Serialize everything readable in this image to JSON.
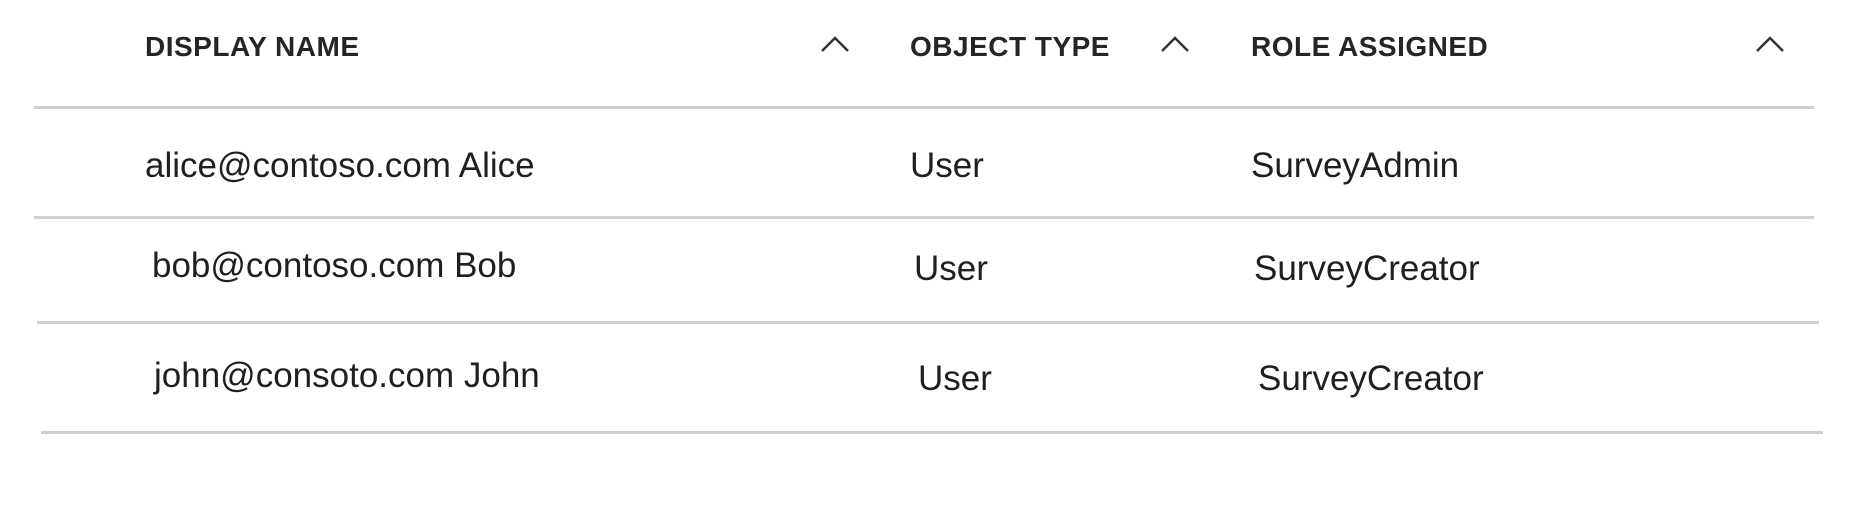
{
  "table": {
    "columns": [
      {
        "label": "DISPLAY NAME",
        "sort_icon": "chevron-up-icon"
      },
      {
        "label": "OBJECT TYPE",
        "sort_icon": "chevron-up-icon"
      },
      {
        "label": "ROLE ASSIGNED",
        "sort_icon": "chevron-up-icon"
      }
    ],
    "rows": [
      {
        "display_name": "alice@contoso.com Alice",
        "object_type": "User",
        "role": "SurveyAdmin"
      },
      {
        "display_name": "bob@contoso.com Bob",
        "object_type": "User",
        "role": "SurveyCreator"
      },
      {
        "display_name": "john@consoto.com John",
        "object_type": "User",
        "role": "SurveyCreator"
      }
    ]
  },
  "colors": {
    "text": "#1f1f1f",
    "divider": "#cfcfcf"
  }
}
